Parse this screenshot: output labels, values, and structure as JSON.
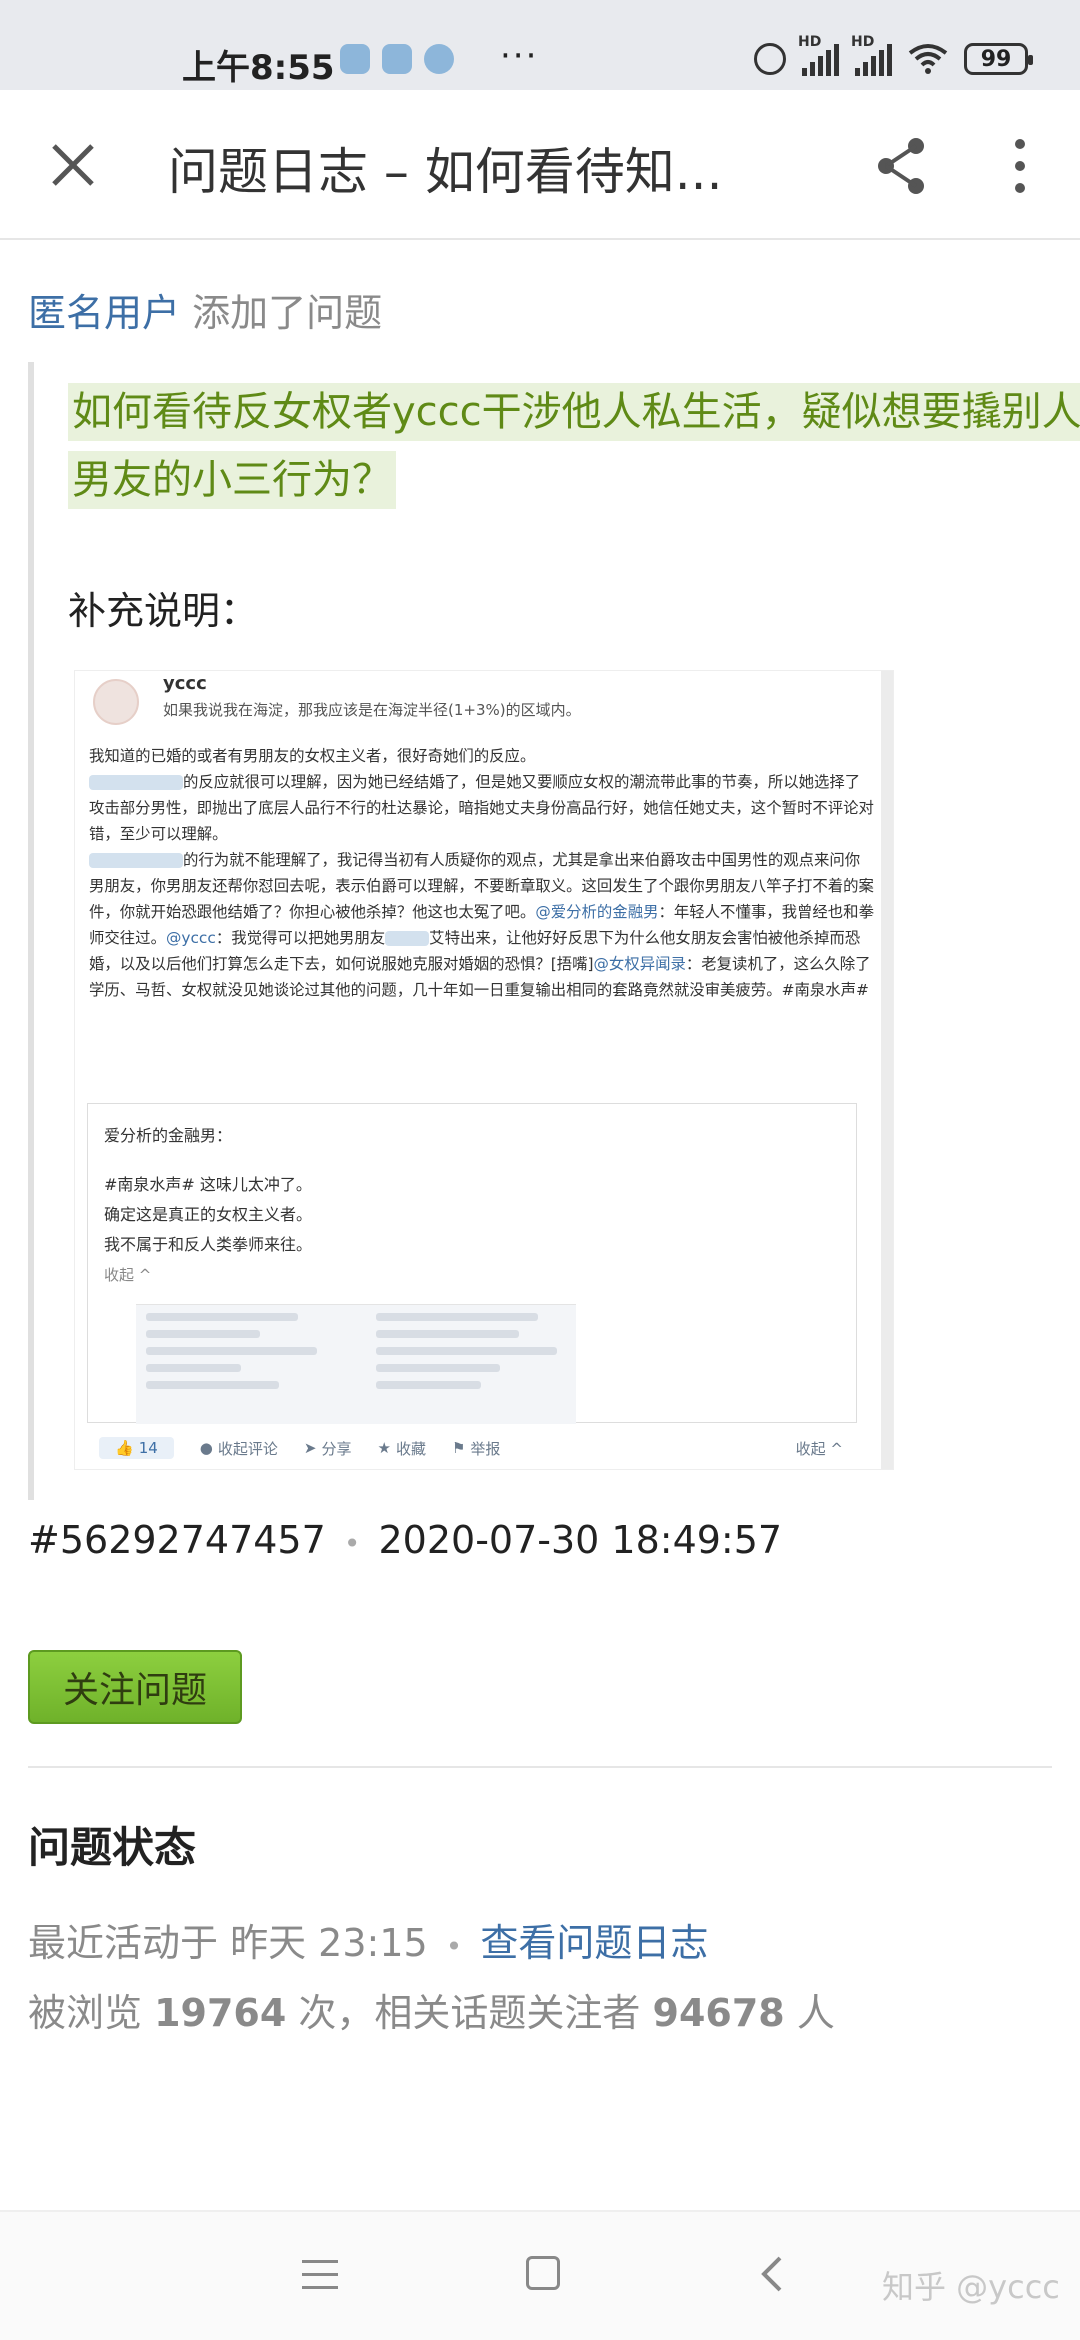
{
  "status_bar": {
    "time": "上午8:55",
    "more": "···",
    "signal_label": "HD",
    "battery": "99"
  },
  "app_bar": {
    "title": "问题日志 – 如何看待知..."
  },
  "log": {
    "user": "匿名用户",
    "action": "添加了问题",
    "question_title": "如何看待反女权者yccc干涉他人私生活，疑似想要撬别人男友的小三行为？",
    "supplement_label": "补充说明："
  },
  "embed": {
    "author": "yccc",
    "location": "如果我说我在海淀，那我应该是在海淀半径(1+3%)的区域内。",
    "p1": "我知道的已婚的或者有男朋友的女权主义者，很好奇她们的反应。",
    "p2a": "的反应就很可以理解，因为她已经结婚了，但是她又要顺应女权的潮流带此事的节奏，所以她选择了攻击部分男性，即抛出了底层人品行不行的杜达暴论，暗指她丈夫身份高品行好，她信任她丈夫，这个暂时不评论对错，至少可以理解。",
    "p3a": "的行为就不能理解了，我记得当初有人质疑你的观点，尤其是拿出来伯爵攻击中国男性的观点来问你男朋友，你男朋友还帮你怼回去呢，表示伯爵可以理解，不要断章取义。这回发生了个跟你男朋友八竿子打不着的案件，你就开始恐跟他结婚了？你担心被他杀掉？他这也太冤了吧。",
    "p3_link1": "@爱分析的金融男",
    "p3b": "：年轻人不懂事，我曾经也和拳师交往过。",
    "p3_link2": "@yccc",
    "p3c": "：我觉得可以把她男朋友",
    "p3d": "艾特出来，让他好好反思下为什么他女朋友会害怕被他杀掉而恐婚，以及以后他们打算怎么走下去，如何说服她克服对婚姻的恐惧？[捂嘴]",
    "p3_link3": "@女权异闻录",
    "p3e": "：老复读机了，这么久除了学历、马哲、女权就没见她谈论过其他的问题，几十年如一日重复输出相同的套路竟然就没审美疲劳。#南泉水声#",
    "card_name": "爱分析的金融男：",
    "card_line1": "#南泉水声# 这味儿太冲了。",
    "card_line2": "确定这是真正的女权主义者。",
    "card_line3": "我不属于和反人类拳师来往。",
    "card_collapse": "收起 ^",
    "likes": "14",
    "action_comment": "收起评论",
    "action_share": "分享",
    "action_fav": "收藏",
    "action_report": "举报",
    "action_collapse": "收起 ^"
  },
  "meta": {
    "id": "#56292747457",
    "datetime": "2020-07-30 18:49:57"
  },
  "follow_button": "关注问题",
  "question_status": {
    "heading": "问题状态",
    "recent_prefix": "最近活动于 昨天 23:15",
    "view_log_link": "查看问题日志",
    "views_prefix": "被浏览",
    "views_count": "19764",
    "views_mid": "次，相关话题关注者",
    "followers_count": "94678",
    "views_suffix": "人"
  },
  "watermark": "知乎 @yccc",
  "colors": {
    "link": "#3d6fa6",
    "question_green": "#5f8a16",
    "follow_button": "#7cc034"
  }
}
